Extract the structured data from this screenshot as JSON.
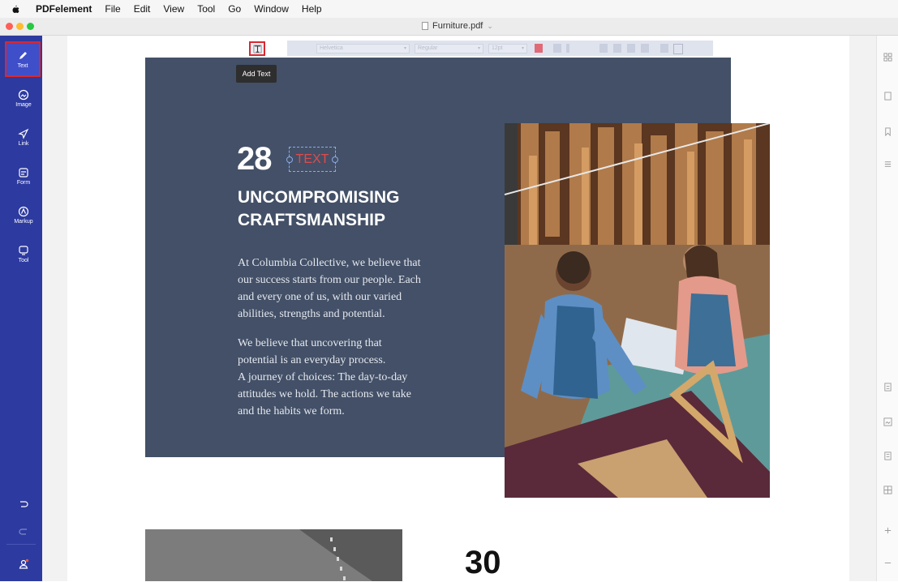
{
  "menubar": {
    "app": "PDFelement",
    "items": [
      "File",
      "Edit",
      "View",
      "Tool",
      "Go",
      "Window",
      "Help"
    ]
  },
  "window": {
    "title": "Furniture.pdf",
    "lights": [
      "#fe5f57",
      "#febc2e",
      "#28c840"
    ]
  },
  "sidebar": {
    "items": [
      {
        "label": "Text",
        "icon": "pencil-icon",
        "active": true
      },
      {
        "label": "Image",
        "icon": "image-icon"
      },
      {
        "label": "Link",
        "icon": "link-icon"
      },
      {
        "label": "Form",
        "icon": "form-icon"
      },
      {
        "label": "Markup",
        "icon": "markup-icon"
      },
      {
        "label": "Tool",
        "icon": "tool-icon"
      }
    ],
    "accent": "#2d3aa0",
    "active_border": "#d9282f"
  },
  "toolbar": {
    "font": "Helvetica",
    "style": "Regular",
    "size": "12pt",
    "tooltip": "Add Text"
  },
  "page": {
    "number": "28",
    "textbox": "TEXT",
    "heading_line1": "UNCOMPROMISING",
    "heading_line2": "CRAFTSMANSHIP",
    "para1": [
      "At Columbia Collective, we believe that",
      "our success starts from our people. Each",
      "and every one of us, with our varied",
      "abilities, strengths and potential."
    ],
    "para2": [
      "We believe that uncovering that",
      "potential is an everyday process.",
      "A journey of choices: The day-to-day",
      "attitudes we hold. The actions we take",
      "and the habits we form."
    ],
    "next_number": "30",
    "block_color": "#435067"
  }
}
